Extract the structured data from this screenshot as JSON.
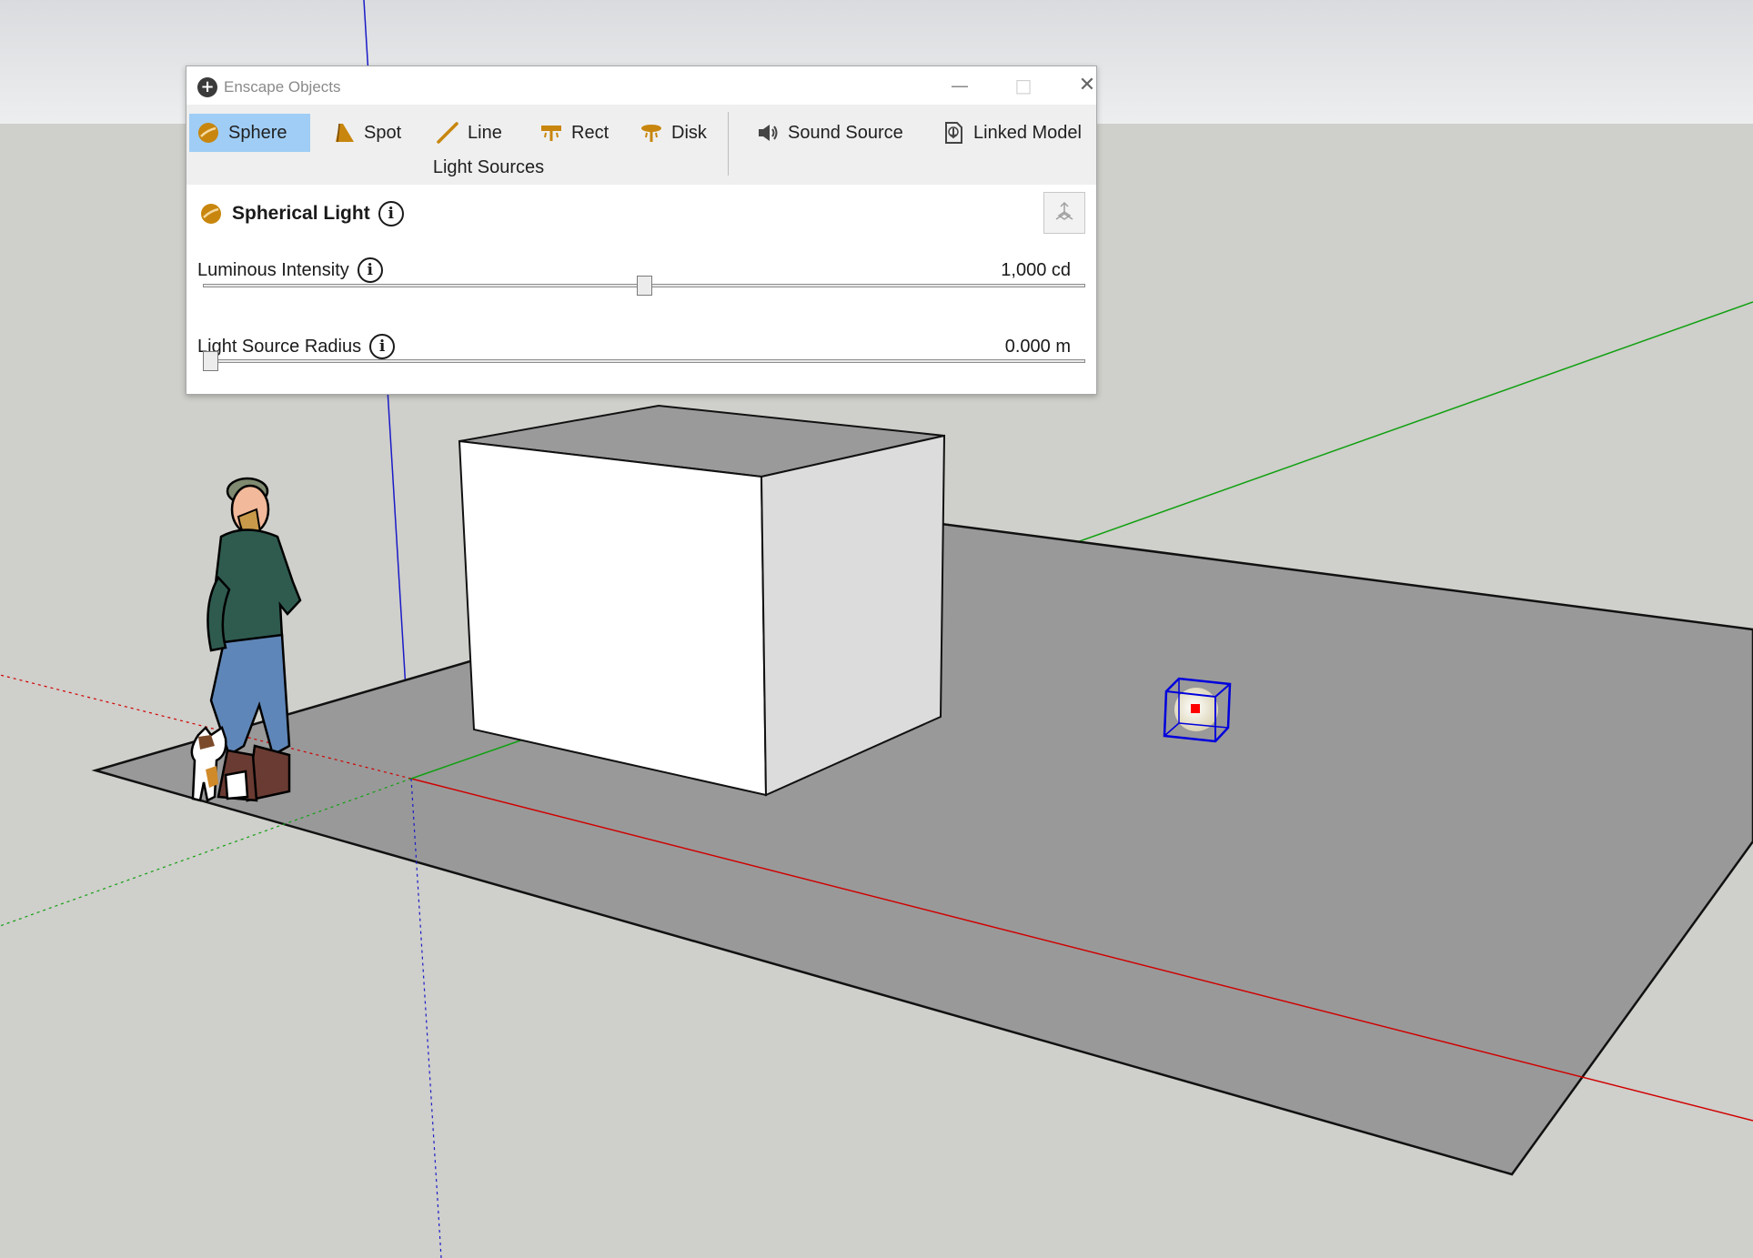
{
  "window": {
    "title": "Enscape Objects",
    "minimize": "—",
    "maximize": "□",
    "close": "✕"
  },
  "toolbar": {
    "items": [
      {
        "label": "Sphere",
        "icon": "sphere-light-icon",
        "active": true
      },
      {
        "label": "Spot",
        "icon": "spot-light-icon"
      },
      {
        "label": "Line",
        "icon": "line-light-icon"
      },
      {
        "label": "Rect",
        "icon": "rect-light-icon"
      },
      {
        "label": "Disk",
        "icon": "disk-light-icon"
      },
      {
        "label": "Sound Source",
        "icon": "speaker-icon"
      },
      {
        "label": "Linked Model",
        "icon": "linked-model-icon"
      }
    ],
    "group_label": "Light Sources"
  },
  "properties": {
    "title": "Spherical Light",
    "luminous_intensity": {
      "label": "Luminous Intensity",
      "value": "1,000 cd",
      "slider_fraction": 0.5
    },
    "light_source_radius": {
      "label": "Light Source Radius",
      "value": "0.000 m",
      "slider_fraction": 0.0
    }
  },
  "colors": {
    "accent_active": "#9fcdf5",
    "light_icon": "#c8860e",
    "ground_plane": "#999999",
    "background": "#cfcfcb",
    "sky": "#e6e7e9",
    "selection": "#0000dd",
    "axis_red": "#d40000",
    "axis_green": "#00a000",
    "axis_blue": "#0000c8"
  }
}
